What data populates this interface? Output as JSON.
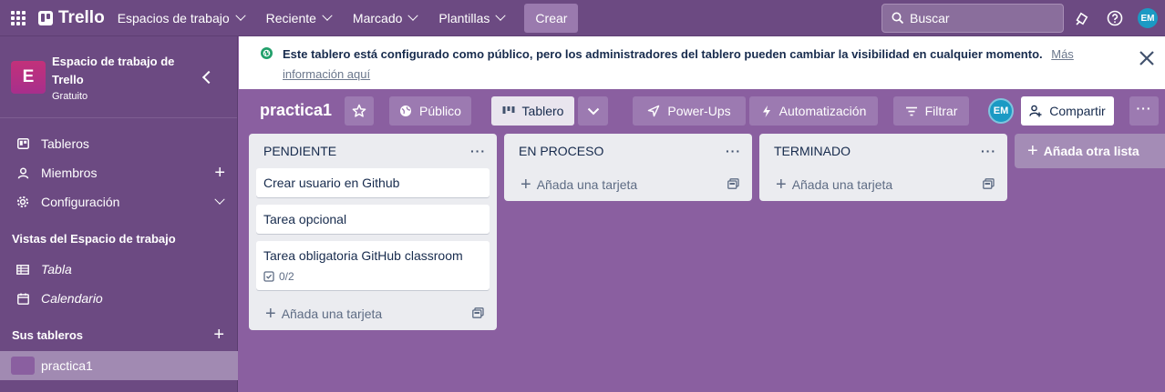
{
  "topbar": {
    "logo": "Trello",
    "nav": [
      "Espacios de trabajo",
      "Reciente",
      "Marcado",
      "Plantillas"
    ],
    "create": "Crear",
    "search_placeholder": "Buscar",
    "avatar": "EM"
  },
  "sidebar": {
    "workspace_initial": "E",
    "workspace_name": "Espacio de trabajo de Trello",
    "workspace_plan": "Gratuito",
    "items": [
      {
        "label": "Tableros",
        "icon": "board-icon"
      },
      {
        "label": "Miembros",
        "icon": "person-icon"
      },
      {
        "label": "Configuración",
        "icon": "gear-icon"
      }
    ],
    "views_heading": "Vistas del Espacio de trabajo",
    "views": [
      {
        "label": "Tabla",
        "icon": "table-icon"
      },
      {
        "label": "Calendario",
        "icon": "calendar-icon"
      }
    ],
    "boards_heading": "Sus tableros",
    "boards": [
      "practica1"
    ]
  },
  "banner": {
    "text": "Este tablero está configurado como público, pero los administradores del tablero pueden cambiar la visibilidad en cualquier momento.",
    "link": "Más información aquí"
  },
  "board": {
    "title": "practica1",
    "visibility": "Público",
    "view": "Tablero",
    "powerups": "Power-Ups",
    "automation": "Automatización",
    "filter": "Filtrar",
    "member_avatar": "EM",
    "share": "Compartir"
  },
  "lists": [
    {
      "title": "PENDIENTE",
      "cards": [
        {
          "title": "Crear usuario en Github"
        },
        {
          "title": "Tarea opcional"
        },
        {
          "title": "Tarea obligatoria GitHub classroom",
          "checklist": "0/2"
        }
      ],
      "add_card": "Añada una tarjeta"
    },
    {
      "title": "EN PROCESO",
      "cards": [],
      "add_card": "Añada una tarjeta"
    },
    {
      "title": "TERMINADO",
      "cards": [],
      "add_card": "Añada una tarjeta"
    }
  ],
  "add_list": "Añada otra lista",
  "colors": {
    "board_bg": "#8a5fa0",
    "nav_bg": "#6c4a82",
    "list_bg": "#ebecf0",
    "badge_gradient": "#c2317a"
  }
}
